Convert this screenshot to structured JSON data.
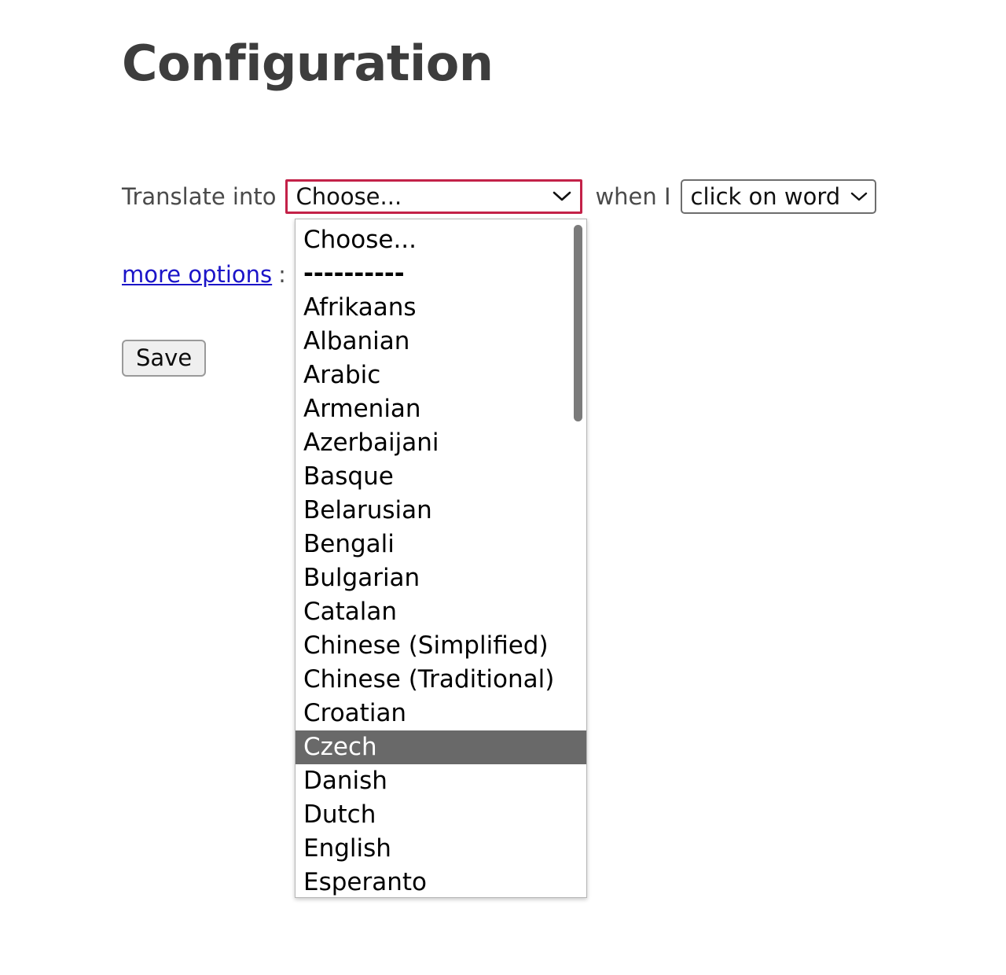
{
  "page": {
    "title": "Configuration"
  },
  "form": {
    "translate_label": "Translate into",
    "when_label": "when I",
    "language_select": {
      "value": "Choose...",
      "chevron_icon": "chevron-down-icon"
    },
    "trigger_select": {
      "value": "click on word",
      "chevron_icon": "chevron-down-icon"
    },
    "more_options_link": "more options",
    "more_options_trailing": ":",
    "save_label": "Save"
  },
  "dropdown": {
    "highlighted_index": 15,
    "highlight_color": "#696969",
    "highlight_text_color": "#ffffff",
    "focus_border_color": "#c32148",
    "items": [
      "Choose...",
      "----------",
      "Afrikaans",
      "Albanian",
      "Arabic",
      "Armenian",
      "Azerbaijani",
      "Basque",
      "Belarusian",
      "Bengali",
      "Bulgarian",
      "Catalan",
      "Chinese (Simplified)",
      "Chinese (Traditional)",
      "Croatian",
      "Czech",
      "Danish",
      "Dutch",
      "English",
      "Esperanto"
    ],
    "scrollbar": {
      "name": "dropdown-scrollbar"
    }
  }
}
